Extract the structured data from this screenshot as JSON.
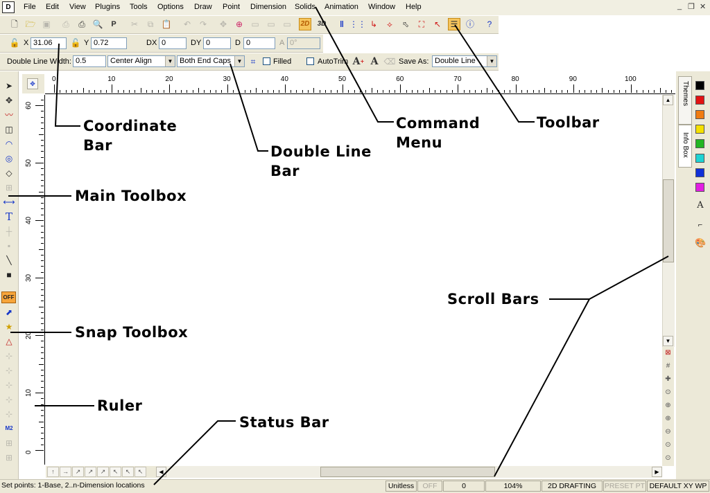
{
  "menubar": {
    "items": [
      "File",
      "Edit",
      "View",
      "Plugins",
      "Tools",
      "Options",
      "Draw",
      "Point",
      "Dimension",
      "Solids",
      "Animation",
      "Window",
      "Help"
    ]
  },
  "toolbar": {
    "btn_2d": "2D",
    "btn_3d": "3D"
  },
  "coordinate_bar": {
    "x_label": "X",
    "x_value": "31.06",
    "y_label": "Y",
    "y_value": "0.72",
    "dx_label": "DX",
    "dx_value": "0",
    "dy_label": "DY",
    "dy_value": "0",
    "d_label": "D",
    "d_value": "0",
    "a_label": "A",
    "a_value": "0°"
  },
  "double_line_bar": {
    "width_label": "Double Line Width:",
    "width_value": "0.5",
    "align_value": "Center Align",
    "caps_value": "Both End Caps",
    "filled_label": "Filled",
    "autotrim_label": "AutoTrim",
    "save_as_label": "Save As:",
    "save_as_value": "Double Line"
  },
  "left_toolbox": {
    "snap_off_label": "OFF"
  },
  "rulers": {
    "horizontal_labels": [
      "0",
      "10",
      "20",
      "30",
      "40",
      "50",
      "60",
      "70",
      "80",
      "90",
      "100"
    ],
    "vertical_labels": [
      "60",
      "50",
      "40",
      "30",
      "20",
      "10",
      "0"
    ]
  },
  "side_panel": {
    "tab_themes": "Themes",
    "tab_info_box": "Info Box",
    "swatch_colors": [
      "#000000",
      "#e21212",
      "#f07c10",
      "#f4e000",
      "#22b622",
      "#1ed3d3",
      "#1030d8",
      "#e21ee2"
    ]
  },
  "status_bar": {
    "message": "Set points: 1-Base, 2..n-Dimension locations",
    "units": "Unitless",
    "snap": "OFF",
    "count": "0",
    "zoom": "104%",
    "mode": "2D DRAFTING",
    "preset": "PRESET PT",
    "plane": "DEFAULT XY WP"
  },
  "callouts": {
    "coordinate_bar": "Coordinate\nBar",
    "double_line_bar": "Double Line\nBar",
    "command_menu": "Command\nMenu",
    "toolbar": "Toolbar",
    "main_toolbox": "Main Toolbox",
    "snap_toolbox": "Snap Toolbox",
    "ruler": "Ruler",
    "status_bar": "Status Bar",
    "scroll_bars": "Scroll Bars"
  }
}
